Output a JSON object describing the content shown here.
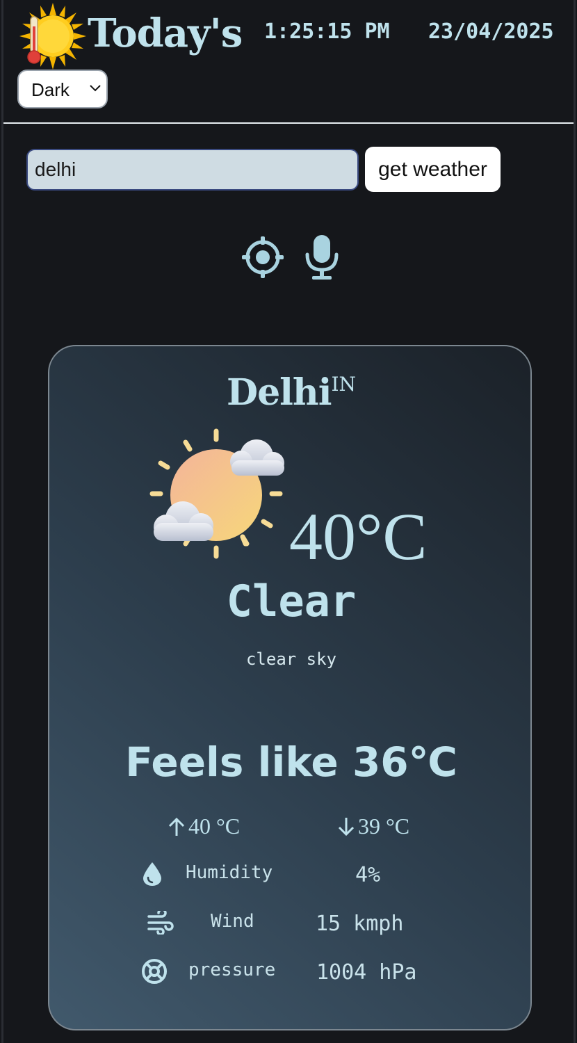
{
  "header": {
    "title": "Today's",
    "time": "1:25:15 PM",
    "date": "23/04/2025",
    "logo_icon": "sun-thermometer-icon"
  },
  "theme_select": {
    "selected": "Dark"
  },
  "search": {
    "value": "delhi",
    "button_label": "get weather",
    "location_icon": "locate-icon",
    "mic_icon": "microphone-icon"
  },
  "weather": {
    "city": "Delhi",
    "country": "IN",
    "icon": "sun-with-clouds-icon",
    "temperature": "40°C",
    "condition": "Clear",
    "description": "clear sky",
    "feels_like": "Feels like 36℃",
    "max_temp": "40 °C",
    "min_temp": "39 °C",
    "details": [
      {
        "icon": "droplet-icon",
        "label": "Humidity",
        "value": "4%"
      },
      {
        "icon": "wind-icon",
        "label": "Wind",
        "value": "15 kmph"
      },
      {
        "icon": "pressure-icon",
        "label": "pressure",
        "value": "1004 hPa"
      }
    ]
  },
  "colors": {
    "background": "#15171b",
    "text_accent": "#bfe2ec",
    "input_bg": "#cfdce3",
    "card_gradient_start": "#41596c",
    "card_gradient_end": "#1b2128"
  }
}
